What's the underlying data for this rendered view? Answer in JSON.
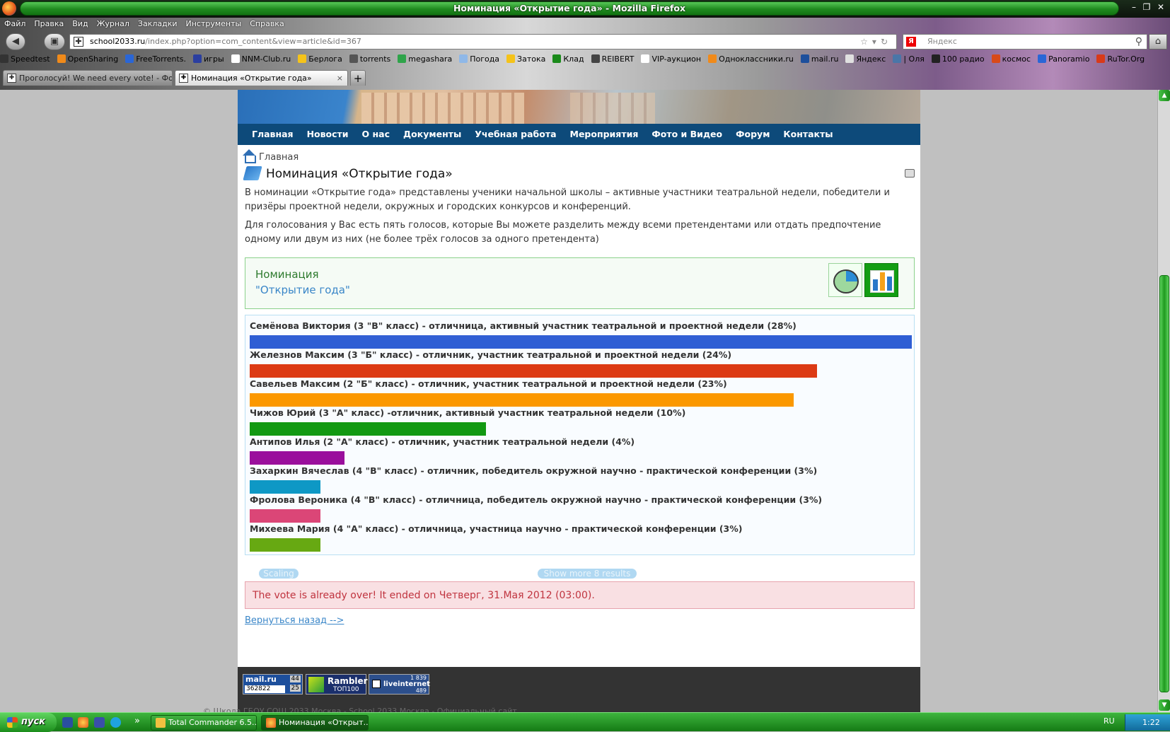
{
  "window": {
    "title": "Номинация «Открытие года» - Mozilla Firefox"
  },
  "menu": [
    "Файл",
    "Правка",
    "Вид",
    "Журнал",
    "Закладки",
    "Инструменты",
    "Справка"
  ],
  "address": {
    "host": "school2033.ru",
    "path": "/index.php?option=com_content&view=article&id=367"
  },
  "search": {
    "placeholder": "Яндекс"
  },
  "bookmarks": [
    {
      "label": "Speedtest",
      "color": "#333333"
    },
    {
      "label": "OpenSharing",
      "color": "#f08a1a"
    },
    {
      "label": "FreeTorrents.",
      "color": "#2a66d6"
    },
    {
      "label": "игры",
      "color": "#2b3fa0"
    },
    {
      "label": "NNM-Club.ru",
      "color": "#ffffff"
    },
    {
      "label": "Берлога",
      "color": "#f5c31a"
    },
    {
      "label": "torrents",
      "color": "#555555"
    },
    {
      "label": "megashara",
      "color": "#2fa44a"
    },
    {
      "label": "Погода",
      "color": "#8fb8e8"
    },
    {
      "label": "Затока",
      "color": "#f5c31a"
    },
    {
      "label": "Клад",
      "color": "#1a8a1a"
    },
    {
      "label": "REIBERT",
      "color": "#444444"
    },
    {
      "label": "VIP-аукцион",
      "color": "#ffffff"
    },
    {
      "label": "Одноклассники.ru",
      "color": "#f08a1a"
    },
    {
      "label": "mail.ru",
      "color": "#1d4f9c"
    },
    {
      "label": "Яндекс",
      "color": "#e0e0e0"
    },
    {
      "label": "| Оля",
      "color": "#4a76a8"
    },
    {
      "label": "100 радио",
      "color": "#222222"
    },
    {
      "label": "космос",
      "color": "#d84a1a"
    },
    {
      "label": "Panoramio",
      "color": "#2a66d6"
    },
    {
      "label": "RuTor.Org",
      "color": "#d83a1a"
    }
  ],
  "tabs": [
    {
      "label": "Проголосуй! We need every vote! - Фо..."
    },
    {
      "label": "Номинация «Открытие года»",
      "close": "×"
    }
  ],
  "newtab": "+",
  "site": {
    "nav": [
      "Главная",
      "Новости",
      "О нас",
      "Документы",
      "Учебная работа",
      "Мероприятия",
      "Фото и Видео",
      "Форум",
      "Контакты"
    ],
    "breadcrumb": "Главная",
    "title": "Номинация «Открытие года»",
    "para1": "В номинации «Открытие года» представлены ученики начальной школы – активные участники театральной недели, победители и призёры проектной недели, окружных и городских конкурсов и конференций.",
    "para2": "Для голосования у Вас есть пять голосов, которые Вы можете разделить между всеми претендентами или отдать предпочтение одному или двум из них (не более трёх голосов за одного претендента)"
  },
  "poll": {
    "heading_line1": "Номинация",
    "heading_line2": "\"Открытие года\"",
    "results": [
      {
        "label": "Семёнова Виктория (3 \"В\" класс) - отличница, активный участник театральной и проектной недели (28%)",
        "value": 28,
        "color": "#2f5ed4"
      },
      {
        "label": "Железнов Максим (3 \"Б\" класс) - отличник, участник театральной и проектной недели (24%)",
        "value": 24,
        "color": "#dc3a14"
      },
      {
        "label": "Савельев Максим (2 \"Б\" класс) - отличник, участник театральной и проектной недели (23%)",
        "value": 23,
        "color": "#fb9800"
      },
      {
        "label": "Чижов Юрий (3 \"А\" класс) -отличник, активный участник театральной недели (10%)",
        "value": 10,
        "color": "#129912"
      },
      {
        "label": "Антипов Илья (2 \"А\" класс) - отличник, участник театральной недели (4%)",
        "value": 4,
        "color": "#9a0f9c"
      },
      {
        "label": "Захаркин Вячеслав (4 \"В\" класс) - отличник, победитель окружной научно - практической конференции (3%)",
        "value": 3,
        "color": "#0e98c5"
      },
      {
        "label": "Фролова Вероника (4 \"В\" класс) - отличница, победитель окружной научно - практической конференции (3%)",
        "value": 3,
        "color": "#db4677"
      },
      {
        "label": "Михеева Мария (4 \"А\" класс) - отличница, участница научно - практической конференции (3%)",
        "value": 3,
        "color": "#67a912"
      }
    ],
    "scaling_label": "Scaling",
    "show_more_label": "Show more 8 results",
    "vote_over": "The vote is already over! It ended on Четверг, 31.Мая 2012 (03:00).",
    "back_link": "Вернуться назад -->"
  },
  "footer": {
    "mail_logo": "mail.ru",
    "mail_count": "362822",
    "mail_r1": "44",
    "mail_r2": "25",
    "rambler_logo": "Rambler",
    "rambler_sub": "ТОП100",
    "live_logo": "liveinternet",
    "live_top": "1 839",
    "live_bottom": "489",
    "copyright": "© Школа ГБОУ СОШ 2033 Москва - School 2033 Москва - Официальный сайт"
  },
  "taskbar": {
    "start": "пуск",
    "more": "»",
    "task1": "Total Commander 6.5...",
    "task2": "Номинация «Открыт...",
    "lang": "RU",
    "clock": "1:22"
  }
}
